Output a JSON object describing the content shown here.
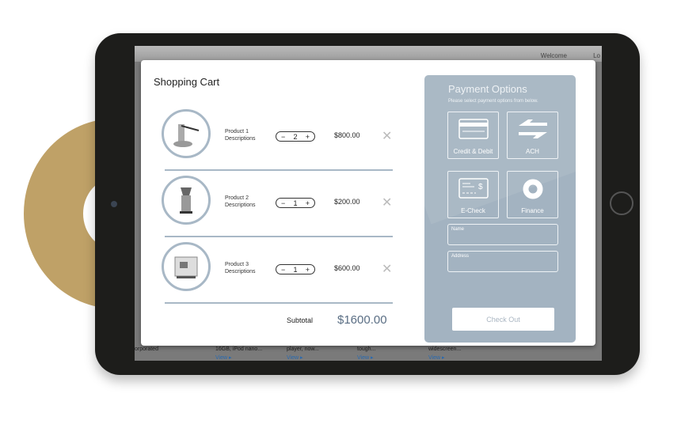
{
  "background_screen": {
    "welcome": "Welcome",
    "login": "Lo",
    "bottom_texts": [
      "orporated",
      "16GB, iPod nano...",
      "player, now...",
      "tough...",
      "widescreen..."
    ],
    "view_link": "View ▸"
  },
  "cart": {
    "title": "Shopping Cart",
    "items": [
      {
        "name": "Product 1",
        "desc": "Descriptions",
        "qty": "2",
        "price": "$800.00"
      },
      {
        "name": "Product 2",
        "desc": "Descriptions",
        "qty": "1",
        "price": "$200.00"
      },
      {
        "name": "Product 3",
        "desc": "Descriptions",
        "qty": "1",
        "price": "$600.00"
      }
    ],
    "minus": "−",
    "plus": "+",
    "remove": "✕",
    "subtotal_label": "Subtotal",
    "subtotal_value": "$1600.00"
  },
  "payment": {
    "title": "Payment Options",
    "subtitle": "Please select payment options from below.",
    "options": [
      {
        "label": "Credit & Debit",
        "icon": "credit-card-icon"
      },
      {
        "label": "ACH",
        "icon": "transfer-arrows-icon"
      },
      {
        "label": "E-Check",
        "icon": "check-icon"
      },
      {
        "label": "Finance",
        "icon": "ring-icon"
      }
    ],
    "name_label": "Name",
    "address_label": "Address",
    "checkout": "Check Out"
  },
  "colors": {
    "panel": "#a3b3c1",
    "accent_ring": "#bfa167",
    "subtotal": "#5a6e84"
  }
}
